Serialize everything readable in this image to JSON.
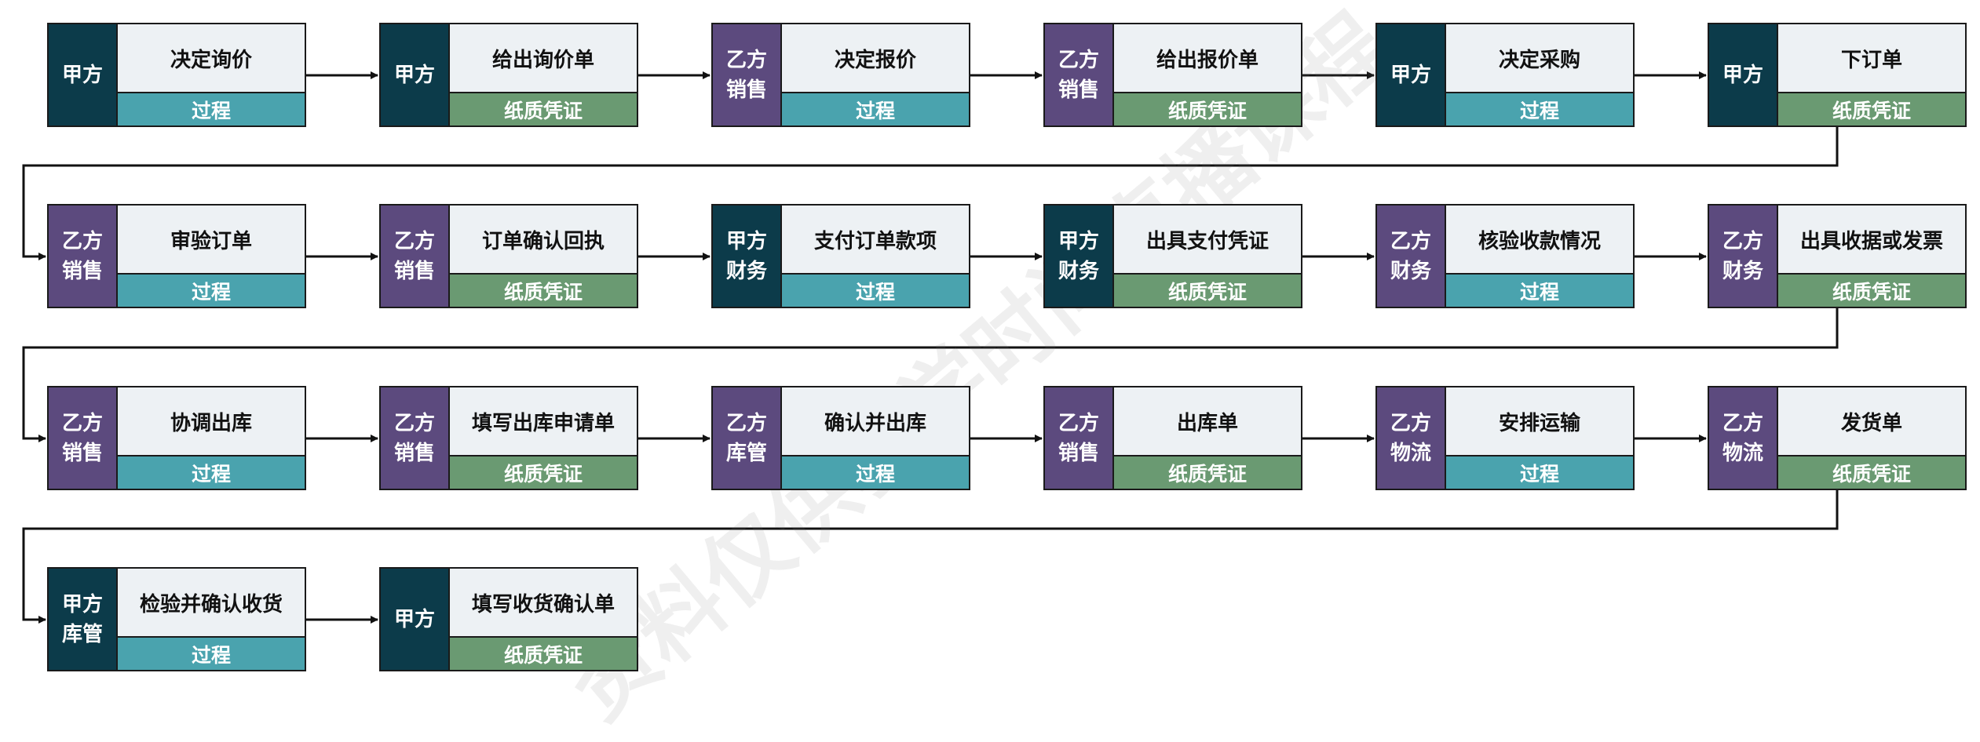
{
  "watermark": "资料仅供教学时间直播课程",
  "colors": {
    "party_a": "#0c3b4a",
    "party_b": "#5c4a7e",
    "process": "#4aa3ae",
    "paper_voucher": "#6a9a72",
    "task_bg": "#edf1f4"
  },
  "nodes": [
    {
      "role": "甲方",
      "party": "jia",
      "task": "决定询价",
      "type": "过程",
      "kind": "process"
    },
    {
      "role": "甲方",
      "party": "jia",
      "task": "给出询价单",
      "type": "纸质凭证",
      "kind": "paper"
    },
    {
      "role": "乙方\n销售",
      "party": "yi",
      "task": "决定报价",
      "type": "过程",
      "kind": "process"
    },
    {
      "role": "乙方\n销售",
      "party": "yi",
      "task": "给出报价单",
      "type": "纸质凭证",
      "kind": "paper"
    },
    {
      "role": "甲方",
      "party": "jia",
      "task": "决定采购",
      "type": "过程",
      "kind": "process"
    },
    {
      "role": "甲方",
      "party": "jia",
      "task": "下订单",
      "type": "纸质凭证",
      "kind": "paper"
    },
    {
      "role": "乙方\n销售",
      "party": "yi",
      "task": "审验订单",
      "type": "过程",
      "kind": "process"
    },
    {
      "role": "乙方\n销售",
      "party": "yi",
      "task": "订单确认回执",
      "type": "纸质凭证",
      "kind": "paper"
    },
    {
      "role": "甲方\n财务",
      "party": "jia",
      "task": "支付订单款项",
      "type": "过程",
      "kind": "process"
    },
    {
      "role": "甲方\n财务",
      "party": "jia",
      "task": "出具支付凭证",
      "type": "纸质凭证",
      "kind": "paper"
    },
    {
      "role": "乙方\n财务",
      "party": "yi",
      "task": "核验收款情况",
      "type": "过程",
      "kind": "process"
    },
    {
      "role": "乙方\n财务",
      "party": "yi",
      "task": "出具收据或发票",
      "type": "纸质凭证",
      "kind": "paper"
    },
    {
      "role": "乙方\n销售",
      "party": "yi",
      "task": "协调出库",
      "type": "过程",
      "kind": "process"
    },
    {
      "role": "乙方\n销售",
      "party": "yi",
      "task": "填写出库申请单",
      "type": "纸质凭证",
      "kind": "paper"
    },
    {
      "role": "乙方\n库管",
      "party": "yi",
      "task": "确认并出库",
      "type": "过程",
      "kind": "process"
    },
    {
      "role": "乙方\n销售",
      "party": "yi",
      "task": "出库单",
      "type": "纸质凭证",
      "kind": "paper"
    },
    {
      "role": "乙方\n物流",
      "party": "yi",
      "task": "安排运输",
      "type": "过程",
      "kind": "process"
    },
    {
      "role": "乙方\n物流",
      "party": "yi",
      "task": "发货单",
      "type": "纸质凭证",
      "kind": "paper"
    },
    {
      "role": "甲方\n库管",
      "party": "jia",
      "task": "检验并确认收货",
      "type": "过程",
      "kind": "process"
    },
    {
      "role": "甲方",
      "party": "jia",
      "task": "填写收货确认单",
      "type": "纸质凭证",
      "kind": "paper"
    }
  ]
}
